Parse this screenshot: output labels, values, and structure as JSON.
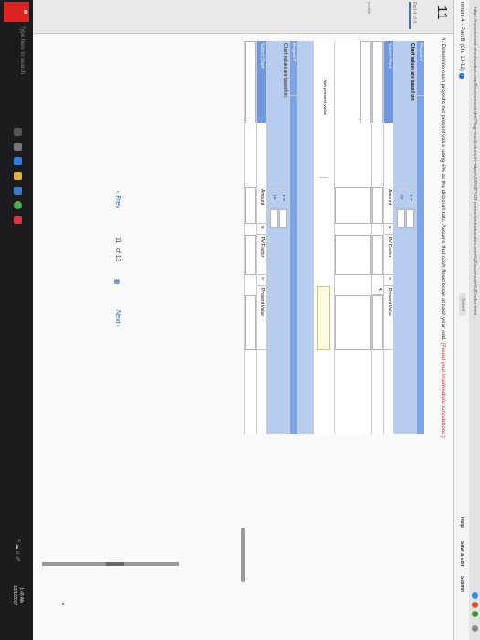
{
  "browser": {
    "url": "https://newconnect.mheducation.com/flow/connect.html?flag=true&returnUrl=https%3A%2F%2Fconnect.mheducation.com%2Fpaamweb%2Findex.html..."
  },
  "header": {
    "breadcrumb": "nment 4 - Part B (Ch. 10-12)",
    "saved": "Saved",
    "help": "Help",
    "save_exit": "Save & Exit",
    "submit": "Submit"
  },
  "sidebar": {
    "question_number": "11",
    "progress": "11 of 13",
    "part": "Part 4 of 4",
    "points": "points"
  },
  "question": {
    "text": "4. Determine each project's net present value using 6% as the discount rate. Assume that cash flows occur at each year-end.",
    "round_note": "(Round your intermediate calculations.)"
  },
  "project_y": {
    "title": "Project Y",
    "chart_label": "Chart values are based on:",
    "n_label": "n =",
    "i_label": "i =",
    "select_chart": "Select Chart",
    "amount": "Amount",
    "times": "x",
    "pv_factor": "PV Factor",
    "equals": "=",
    "present_value": "Present Value",
    "npv_label": "Net present value",
    "currency": "$"
  },
  "project_z": {
    "title": "Project Z",
    "chart_label": "Chart values are based on:",
    "n_label": "n =",
    "i_label": "i =",
    "select_chart": "Select Chart",
    "amount": "Amount",
    "times": "x",
    "pv_factor": "PV Factor",
    "equals": "=",
    "present_value": "Present Value"
  },
  "pager": {
    "prev": "Prev",
    "current": "11",
    "of": "of 13",
    "next": "Next"
  },
  "taskbar": {
    "search": "Type here to search",
    "time": "1:48 AM",
    "date": "12/1/2017"
  }
}
